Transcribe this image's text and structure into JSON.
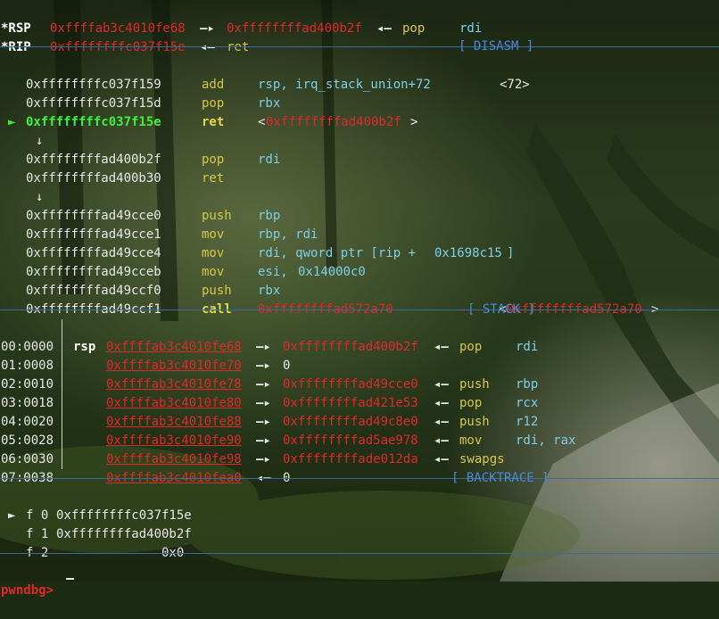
{
  "registers": [
    {
      "name": "*RSP",
      "addr": "0xffffab3c4010fe68",
      "arrow1": "—▸",
      "val": "0xffffffffad400b2f",
      "arrow2": "◂—",
      "op": "pop",
      "arg": "rdi"
    },
    {
      "name": "*RIP",
      "addr": "0xffffffffc037f15e",
      "arrow1": "◂—",
      "op": "ret"
    }
  ],
  "sections": {
    "disasm": "[ DISASM ]",
    "stack": "[ STACK ]",
    "backtrace": "[ BACKTRACE ]"
  },
  "disasm": [
    {
      "addr": "0xffffffffc037f159",
      "mn": "add",
      "ops": "rsp, irq_stack_union+72",
      "extra": "<72>"
    },
    {
      "addr": "0xffffffffc037f15d",
      "mn": "pop",
      "ops": "rbx"
    },
    {
      "addr": "0xffffffffc037f15e",
      "mn": "ret",
      "target": "0xffffffffad400b2f",
      "current": true,
      "marker": "►"
    },
    {
      "down": "↓"
    },
    {
      "addr": "0xffffffffad400b2f",
      "mn": "pop",
      "ops": "rdi"
    },
    {
      "addr": "0xffffffffad400b30",
      "mn": "ret"
    },
    {
      "down": "↓"
    },
    {
      "addr": "0xffffffffad49cce0",
      "mn": "push",
      "ops": "rbp"
    },
    {
      "addr": "0xffffffffad49cce1",
      "mn": "mov",
      "ops": "rbp, rdi"
    },
    {
      "addr": "0xffffffffad49cce4",
      "mn": "mov",
      "ops_a": "rdi, qword ptr [rip + ",
      "ops_b": "0x1698c15",
      "ops_c": "]"
    },
    {
      "addr": "0xffffffffad49cceb",
      "mn": "mov",
      "ops_a": "esi, ",
      "ops_b": "0x14000c0"
    },
    {
      "addr": "0xffffffffad49ccf0",
      "mn": "push",
      "ops": "rbx"
    },
    {
      "addr": "0xffffffffad49ccf1",
      "mn": "call",
      "target": "0xffffffffad572a70",
      "target2": "0xffffffffad572a70"
    }
  ],
  "stack": [
    {
      "idx": "00:0000",
      "reg": "rsp",
      "addr": "0xffffab3c4010fe68",
      "arrow": "—▸",
      "val": "0xffffffffad400b2f",
      "arrow2": "◂—",
      "op": "pop",
      "arg": "rdi"
    },
    {
      "idx": "01:0008",
      "addr": "0xffffab3c4010fe70",
      "arrow": "—▸",
      "val": "0"
    },
    {
      "idx": "02:0010",
      "addr": "0xffffab3c4010fe78",
      "arrow": "—▸",
      "val": "0xffffffffad49cce0",
      "arrow2": "◂—",
      "op": "push",
      "arg": "rbp"
    },
    {
      "idx": "03:0018",
      "addr": "0xffffab3c4010fe80",
      "arrow": "—▸",
      "val": "0xffffffffad421e53",
      "arrow2": "◂—",
      "op": "pop",
      "arg": "rcx"
    },
    {
      "idx": "04:0020",
      "addr": "0xffffab3c4010fe88",
      "arrow": "—▸",
      "val": "0xffffffffad49c8e0",
      "arrow2": "◂—",
      "op": "push",
      "arg": "r12"
    },
    {
      "idx": "05:0028",
      "addr": "0xffffab3c4010fe90",
      "arrow": "—▸",
      "val": "0xffffffffad5ae978",
      "arrow2": "◂—",
      "op": "mov",
      "arg": "rdi, rax"
    },
    {
      "idx": "06:0030",
      "addr": "0xffffab3c4010fe98",
      "arrow": "—▸",
      "val": "0xffffffffade012da",
      "arrow2": "◂—",
      "op": "swapgs"
    },
    {
      "idx": "07:0038",
      "addr": "0xffffab3c4010fea0",
      "arrow": "◂—",
      "val": "0"
    }
  ],
  "backtrace": [
    {
      "marker": "►",
      "frame": "f 0",
      "addr": "0xffffffffc037f15e"
    },
    {
      "frame": "f 1",
      "addr": "0xffffffffad400b2f"
    },
    {
      "frame": "f 2",
      "addr": "0x0"
    }
  ],
  "prompt": "pwndbg>",
  "colors": {
    "red": "#e02a2a",
    "yellow": "#d6c845",
    "cyan": "#7fd0e8",
    "green": "#3df03d",
    "separator": "#3d6aa5"
  }
}
